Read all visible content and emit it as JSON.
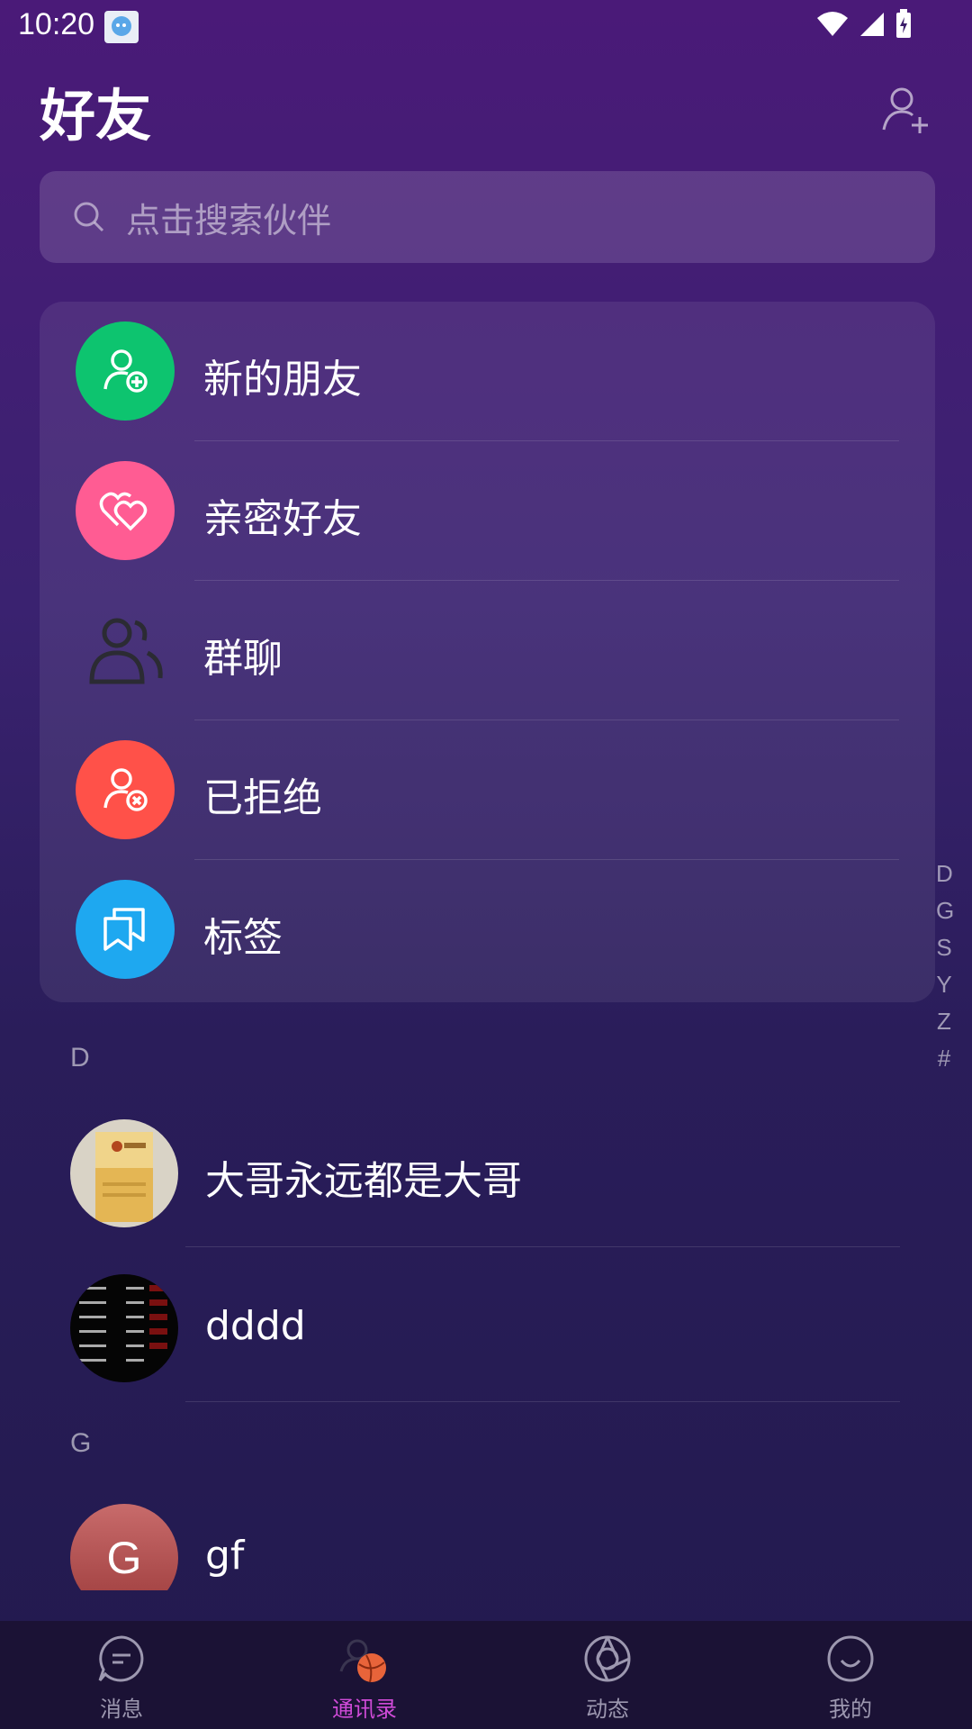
{
  "status": {
    "time": "10:20"
  },
  "header": {
    "title": "好友"
  },
  "search": {
    "placeholder": "点击搜索伙伴"
  },
  "menu": [
    {
      "label": "新的朋友",
      "icon": "add-person-icon",
      "color": "#0dc46f"
    },
    {
      "label": "亲密好友",
      "icon": "hearts-icon",
      "color": "#ff5c93"
    },
    {
      "label": "群聊",
      "icon": "group-icon",
      "color": "transparent"
    },
    {
      "label": "已拒绝",
      "icon": "rejected-person-icon",
      "color": "#ff5149"
    },
    {
      "label": "标签",
      "icon": "tag-icon",
      "color": "#1ea8f0"
    }
  ],
  "sections": [
    {
      "letter": "D",
      "contacts": [
        {
          "name": "大哥永远都是大哥"
        },
        {
          "name": "dddd"
        }
      ]
    },
    {
      "letter": "G",
      "contacts": [
        {
          "name": "gf",
          "initial": "G"
        }
      ]
    }
  ],
  "alpha_index": [
    "D",
    "G",
    "S",
    "Y",
    "Z",
    "#"
  ],
  "tabs": [
    {
      "label": "消息",
      "icon": "message-icon"
    },
    {
      "label": "通讯录",
      "icon": "contacts-icon",
      "active": true
    },
    {
      "label": "动态",
      "icon": "aperture-icon"
    },
    {
      "label": "我的",
      "icon": "smile-icon"
    }
  ],
  "colors": {
    "active_tab": "#d04bd8",
    "tab_bar": "#1b1235"
  }
}
